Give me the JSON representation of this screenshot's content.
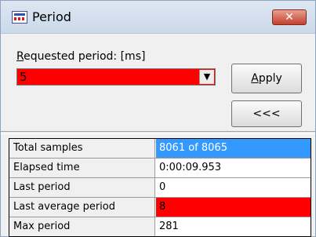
{
  "window": {
    "title": "Period",
    "close_glyph": "✕",
    "icon": "app-icon"
  },
  "request": {
    "label": "Requested period: [ms]",
    "value": "5",
    "dropdown_glyph": "▼"
  },
  "buttons": {
    "apply": "Apply",
    "back": "<<<"
  },
  "colors": {
    "alert": "#ff0000",
    "selection": "#3399ff"
  },
  "stats": [
    {
      "label": "Total samples",
      "value": "8061 of 8065",
      "style": "selected"
    },
    {
      "label": "Elapsed time",
      "value": "0:00:09.953",
      "style": "normal"
    },
    {
      "label": "Last period",
      "value": "0",
      "style": "normal"
    },
    {
      "label": "Last average period",
      "value": "8",
      "style": "alert"
    },
    {
      "label": "Max period",
      "value": "281",
      "style": "normal"
    }
  ]
}
